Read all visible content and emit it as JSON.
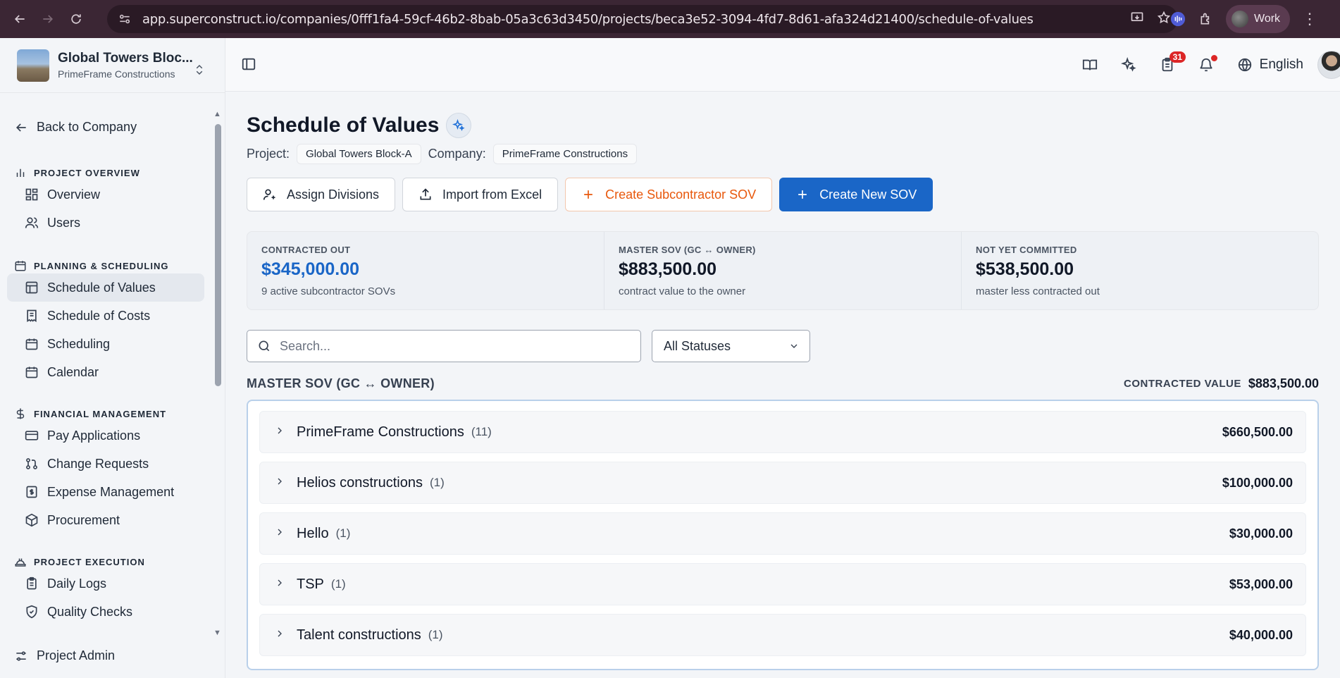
{
  "browser": {
    "url": "app.superconstruct.io/companies/0fff1fa4-59cf-46b2-8bab-05a3c63d3450/projects/beca3e52-3094-4fd7-8d61-afa324d21400/schedule-of-values",
    "profile": "Work"
  },
  "project": {
    "name": "Global Towers Bloc...",
    "company": "PrimeFrame Constructions"
  },
  "sidebar": {
    "back": "Back to Company",
    "sections": [
      {
        "title": "PROJECT OVERVIEW",
        "items": [
          "Overview",
          "Users"
        ]
      },
      {
        "title": "PLANNING & SCHEDULING",
        "items": [
          "Schedule of Values",
          "Schedule of Costs",
          "Scheduling",
          "Calendar"
        ]
      },
      {
        "title": "FINANCIAL MANAGEMENT",
        "items": [
          "Pay Applications",
          "Change Requests",
          "Expense Management",
          "Procurement"
        ]
      },
      {
        "title": "PROJECT EXECUTION",
        "items": [
          "Daily Logs",
          "Quality Checks"
        ]
      }
    ],
    "admin": "Project Admin",
    "active_item": "Schedule of Values"
  },
  "topbar": {
    "task_count": "31",
    "language": "English"
  },
  "page": {
    "title": "Schedule of Values",
    "project_label": "Project:",
    "project_value": "Global Towers Block-A",
    "company_label": "Company:",
    "company_value": "PrimeFrame Constructions"
  },
  "actions": {
    "assign": "Assign Divisions",
    "import": "Import from Excel",
    "create_sub": "Create Subcontractor SOV",
    "create_new": "Create New SOV"
  },
  "stats": [
    {
      "label": "CONTRACTED OUT",
      "value": "$345,000.00",
      "sub": "9 active subcontractor SOVs"
    },
    {
      "label": "MASTER SOV (GC ↔ OWNER)",
      "value": "$883,500.00",
      "sub": "contract value to the owner"
    },
    {
      "label": "NOT YET COMMITTED",
      "value": "$538,500.00",
      "sub": "master less contracted out"
    }
  ],
  "filters": {
    "search_placeholder": "Search...",
    "status": "All Statuses"
  },
  "master_sov": {
    "title": "MASTER SOV (GC ↔ OWNER)",
    "contracted_label": "CONTRACTED VALUE",
    "contracted_value": "$883,500.00",
    "rows": [
      {
        "name": "PrimeFrame Constructions",
        "count": "(11)",
        "amount": "$660,500.00"
      },
      {
        "name": "Helios constructions",
        "count": "(1)",
        "amount": "$100,000.00"
      },
      {
        "name": "Hello",
        "count": "(1)",
        "amount": "$30,000.00"
      },
      {
        "name": "TSP",
        "count": "(1)",
        "amount": "$53,000.00"
      },
      {
        "name": "Talent constructions",
        "count": "(1)",
        "amount": "$40,000.00"
      }
    ]
  },
  "colors": {
    "primary": "#1a66c7",
    "orange": "#e8580c",
    "chrome": "#3b2634"
  }
}
